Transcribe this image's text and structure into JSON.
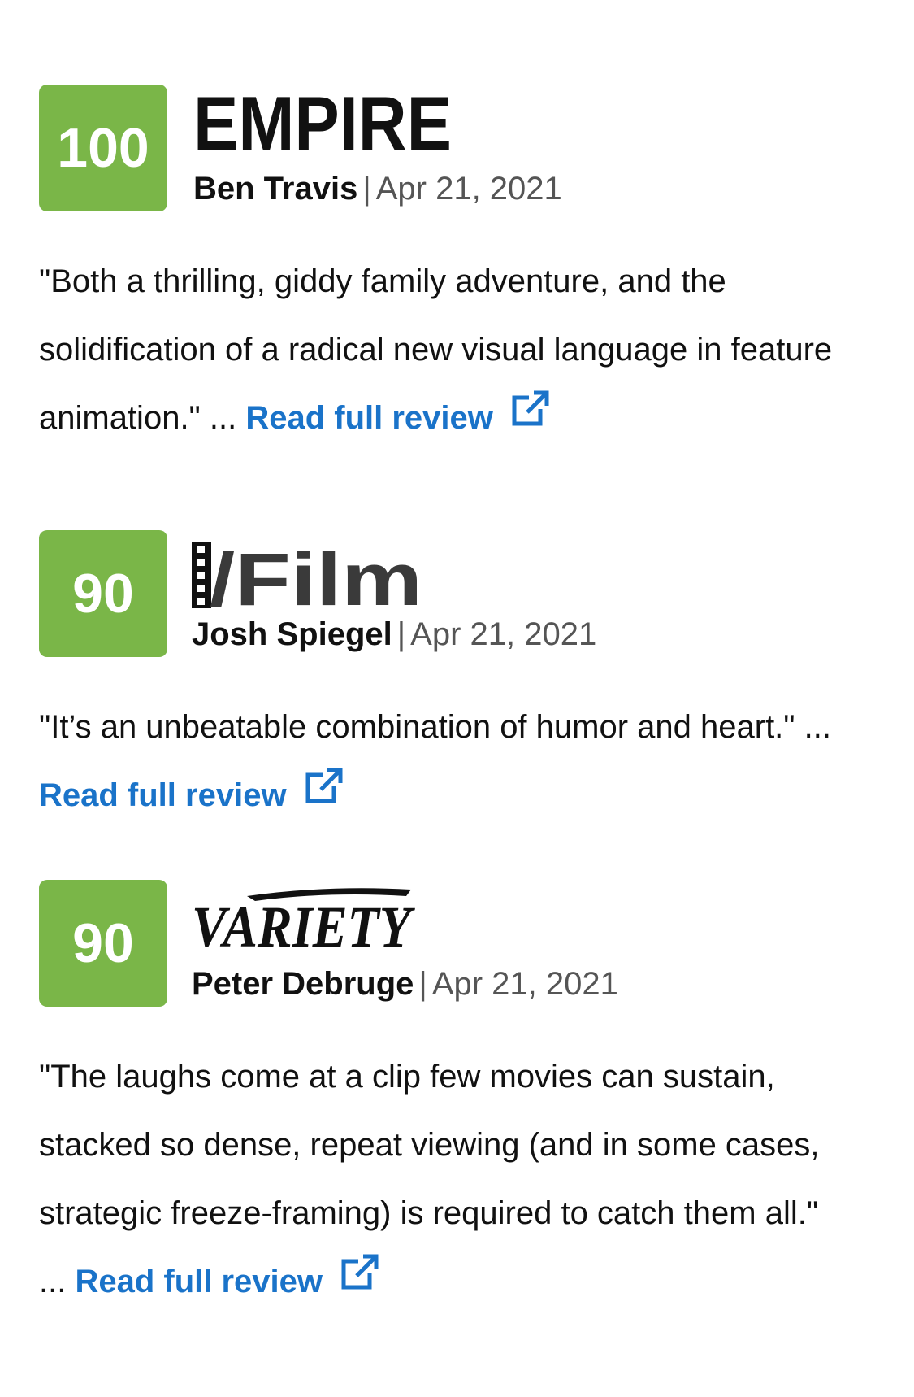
{
  "reviews": [
    {
      "score": "100",
      "publication": "EMPIRE",
      "critic": "Ben Travis",
      "separator": "|",
      "date": "Apr 21, 2021",
      "quote": "\"Both a thrilling, giddy family adventure, and the solidification of a radical new visual language in feature animation.\" ...",
      "link_label": "Read full review"
    },
    {
      "score": "90",
      "publication": "/Film",
      "critic": "Josh Spiegel",
      "separator": "|",
      "date": "Apr 21, 2021",
      "quote": "\"It’s an unbeatable combination of humor and heart.\" ...",
      "link_label": "Read full review"
    },
    {
      "score": "90",
      "publication": "VARIETY",
      "critic": "Peter Debruge",
      "separator": "|",
      "date": "Apr 21, 2021",
      "quote": "\"The laughs come at a clip few movies can sustain, stacked so dense, repeat viewing (and in some cases, strategic freeze-framing) is required to catch them all.\" ...",
      "link_label": "Read full review"
    }
  ],
  "colors": {
    "score_bg": "#7ab648",
    "link": "#1a73c9"
  },
  "icons": {
    "external_link": "external-link-icon"
  }
}
